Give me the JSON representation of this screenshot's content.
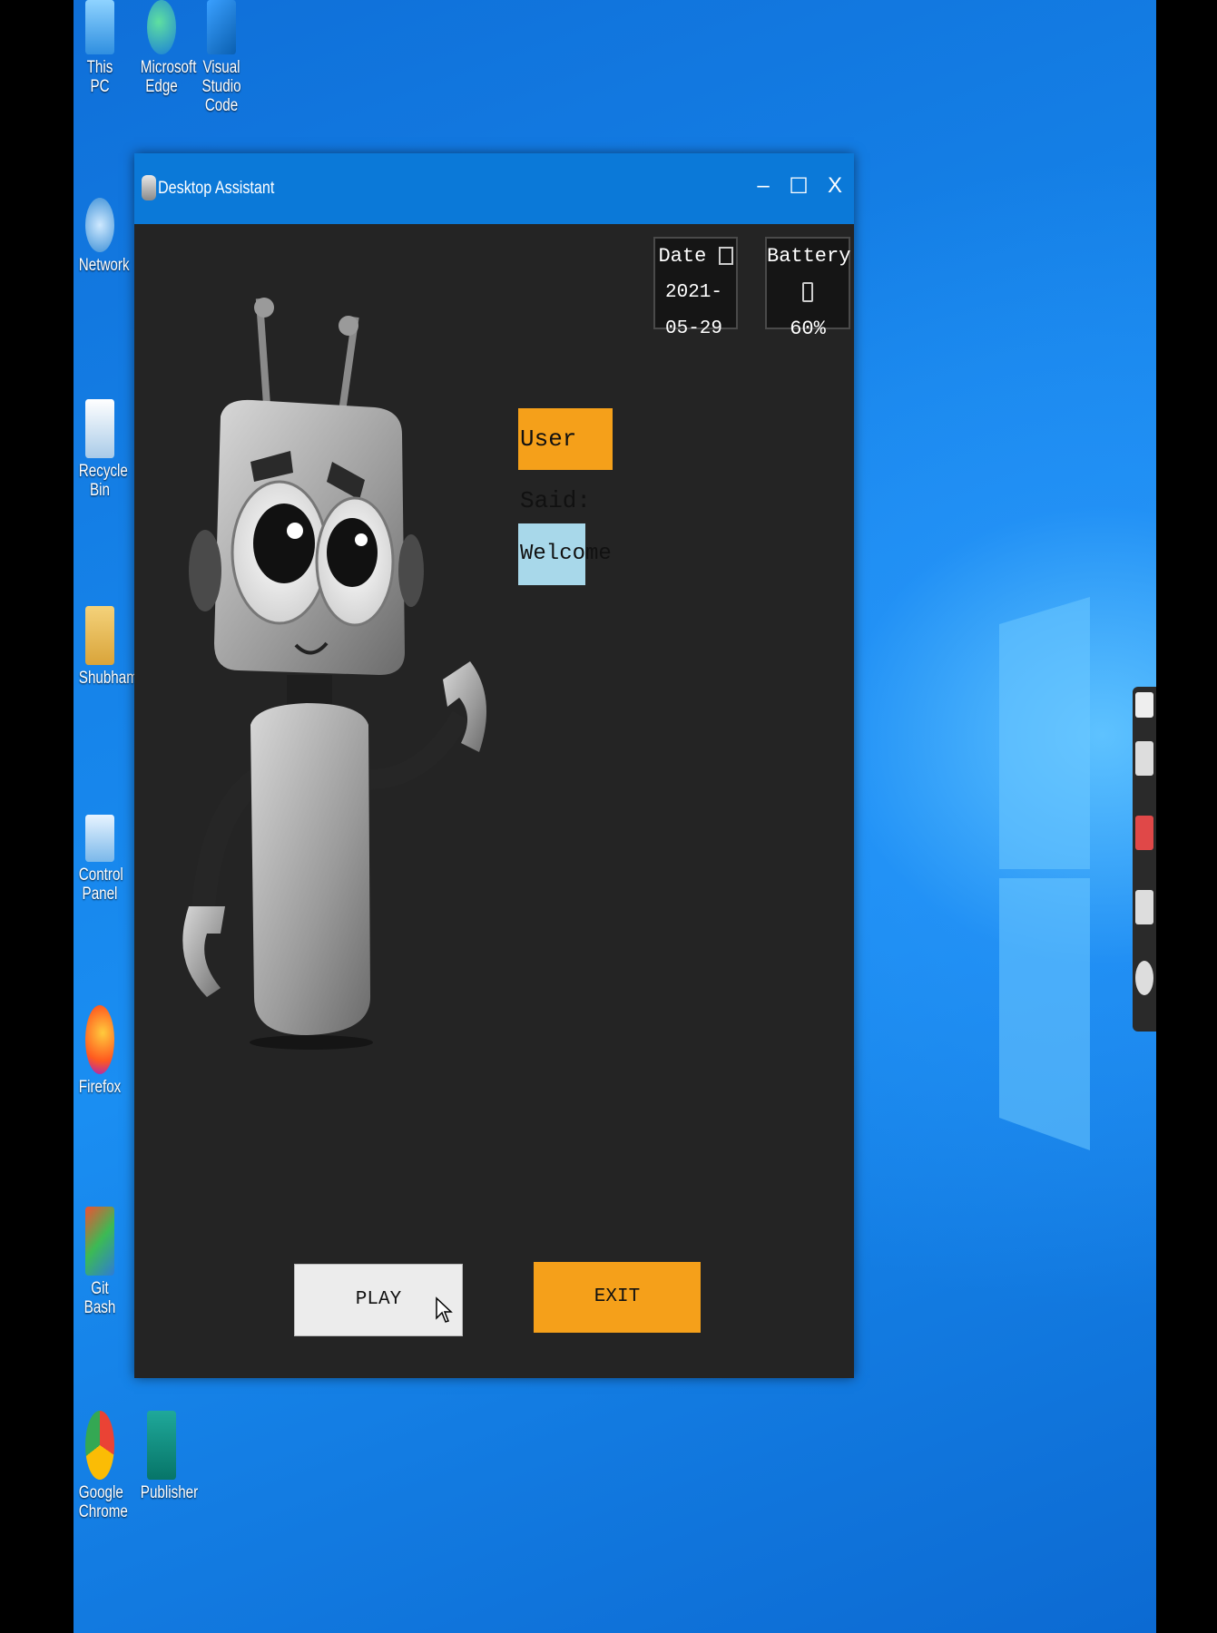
{
  "desktop": {
    "icons": [
      {
        "label": "This PC",
        "kind": "computer-icon"
      },
      {
        "label": "Microsoft Edge",
        "kind": "edge-icon"
      },
      {
        "label": "Visual Studio Code",
        "kind": "vscode-icon"
      },
      {
        "label": "Network",
        "kind": "network-icon"
      },
      {
        "label": "Recycle Bin",
        "kind": "recycle-bin-icon"
      },
      {
        "label": "Shubham",
        "kind": "user-folder-icon"
      },
      {
        "label": "Control Panel",
        "kind": "control-panel-icon"
      },
      {
        "label": "Firefox",
        "kind": "firefox-icon"
      },
      {
        "label": "Git Bash",
        "kind": "git-bash-icon"
      },
      {
        "label": "Google Chrome",
        "kind": "chrome-icon"
      },
      {
        "label": "Publisher",
        "kind": "publisher-icon"
      }
    ]
  },
  "window": {
    "title": "Desktop Assistant",
    "controls": {
      "minimize": "–",
      "maximize": "☐",
      "close": "X"
    },
    "date": {
      "label": "Date",
      "value": "2021-05-29"
    },
    "battery": {
      "label": "Battery",
      "value": "60%"
    },
    "user_said_label": "User Said:",
    "response": "Welcome",
    "play_label": "PLAY",
    "exit_label": "EXIT"
  },
  "colors": {
    "accent": "#f5a01a",
    "response_bg": "#a8d8ea",
    "window_bg": "#242424",
    "titlebar": "#0b79d8"
  }
}
